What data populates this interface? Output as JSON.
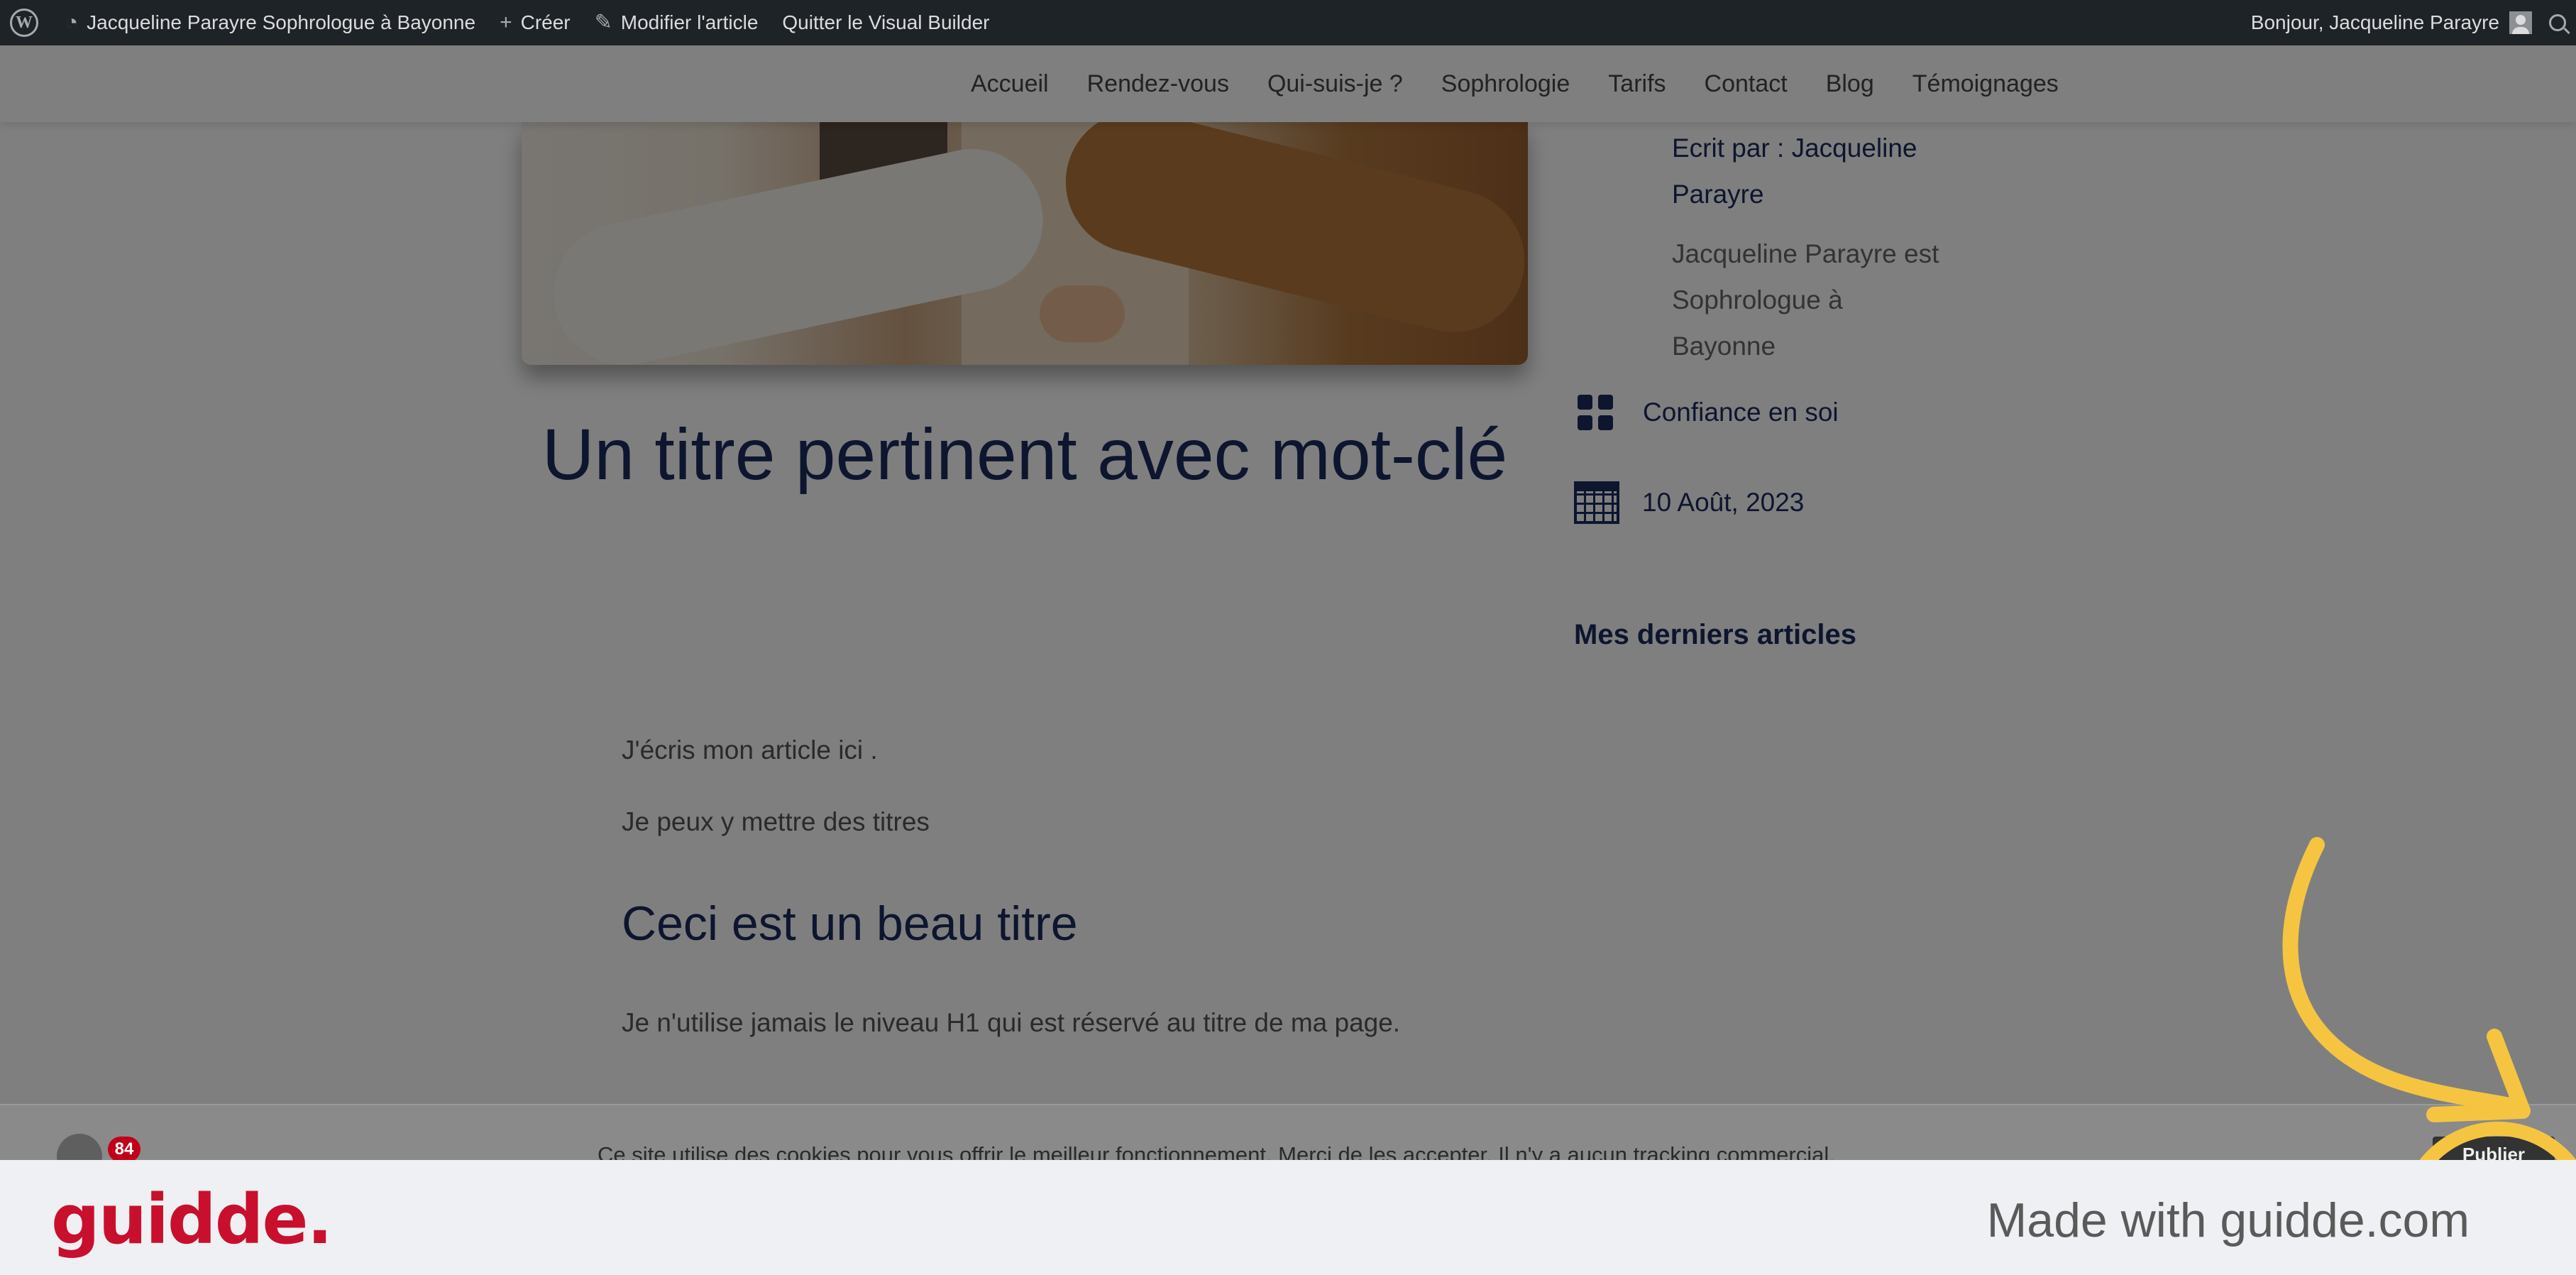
{
  "admin_bar": {
    "site_name": "Jacqueline Parayre Sophrologue à Bayonne",
    "create_label": "Créer",
    "edit_label": "Modifier l'article",
    "exit_builder_label": "Quitter le Visual Builder",
    "greeting": "Bonjour, Jacqueline Parayre",
    "wp_logo_letter": "W"
  },
  "nav": {
    "items": [
      "Accueil",
      "Rendez-vous",
      "Qui-suis-je ?",
      "Sophrologie",
      "Tarifs",
      "Contact",
      "Blog",
      "Témoignages"
    ]
  },
  "article": {
    "title": "Un titre pertinent avec mot-clé",
    "paragraphs": [
      "J'écris mon article ici .",
      "Je peux y mettre des titres",
      "Je n'utilise jamais le niveau H1 qui est réservé au titre de ma page."
    ],
    "heading": "Ceci est un beau titre"
  },
  "sidebar": {
    "author_lines": [
      "Ecrit par : Jacqueline",
      "Parayre"
    ],
    "bio_lines": [
      "Jacqueline Parayre est",
      "Sophrologue à",
      "Bayonne"
    ],
    "category": "Confiance en soi",
    "date": "10 Août, 2023",
    "recent_title": "Mes derniers articles"
  },
  "cookie": {
    "text": "Ce site utilise des cookies pour vous offrir le meilleur fonctionnement. Merci de les accepter. Il n'y a aucun tracking commercial.",
    "button_label": "Publier",
    "badge_count": "84"
  },
  "footer": {
    "logo": "guidde.",
    "made_with": "Made with guidde.com"
  },
  "colors": {
    "brand_red": "#c8102e",
    "heading_navy": "#1a2a5e",
    "annotation_yellow": "#f5c542",
    "admin_bar": "#1d2327"
  }
}
